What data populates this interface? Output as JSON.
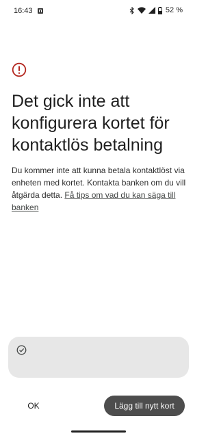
{
  "status_bar": {
    "time": "16:43",
    "battery": "52 %",
    "icons": [
      "notification-app-icon",
      "bluetooth-icon",
      "wifi-icon",
      "signal-icon",
      "battery-icon"
    ]
  },
  "dialog": {
    "icon": "error-icon",
    "title": "Det gick inte att konfigurera kortet för kontaktlös betalning",
    "body": "Du kommer inte att kunna betala kontaktlöst via enheten med kortet. Kontakta banken om du vill åtgärda detta. ",
    "link": "Få tips om vad du kan säga till banken"
  },
  "info_card": {
    "icon": "check-circle-icon"
  },
  "actions": {
    "ok_label": "OK",
    "add_card_label": "Lägg till nytt kort"
  },
  "colors": {
    "error": "#b3261e",
    "card_background": "#e7e7e7",
    "primary_button": "#4d4d4d"
  }
}
